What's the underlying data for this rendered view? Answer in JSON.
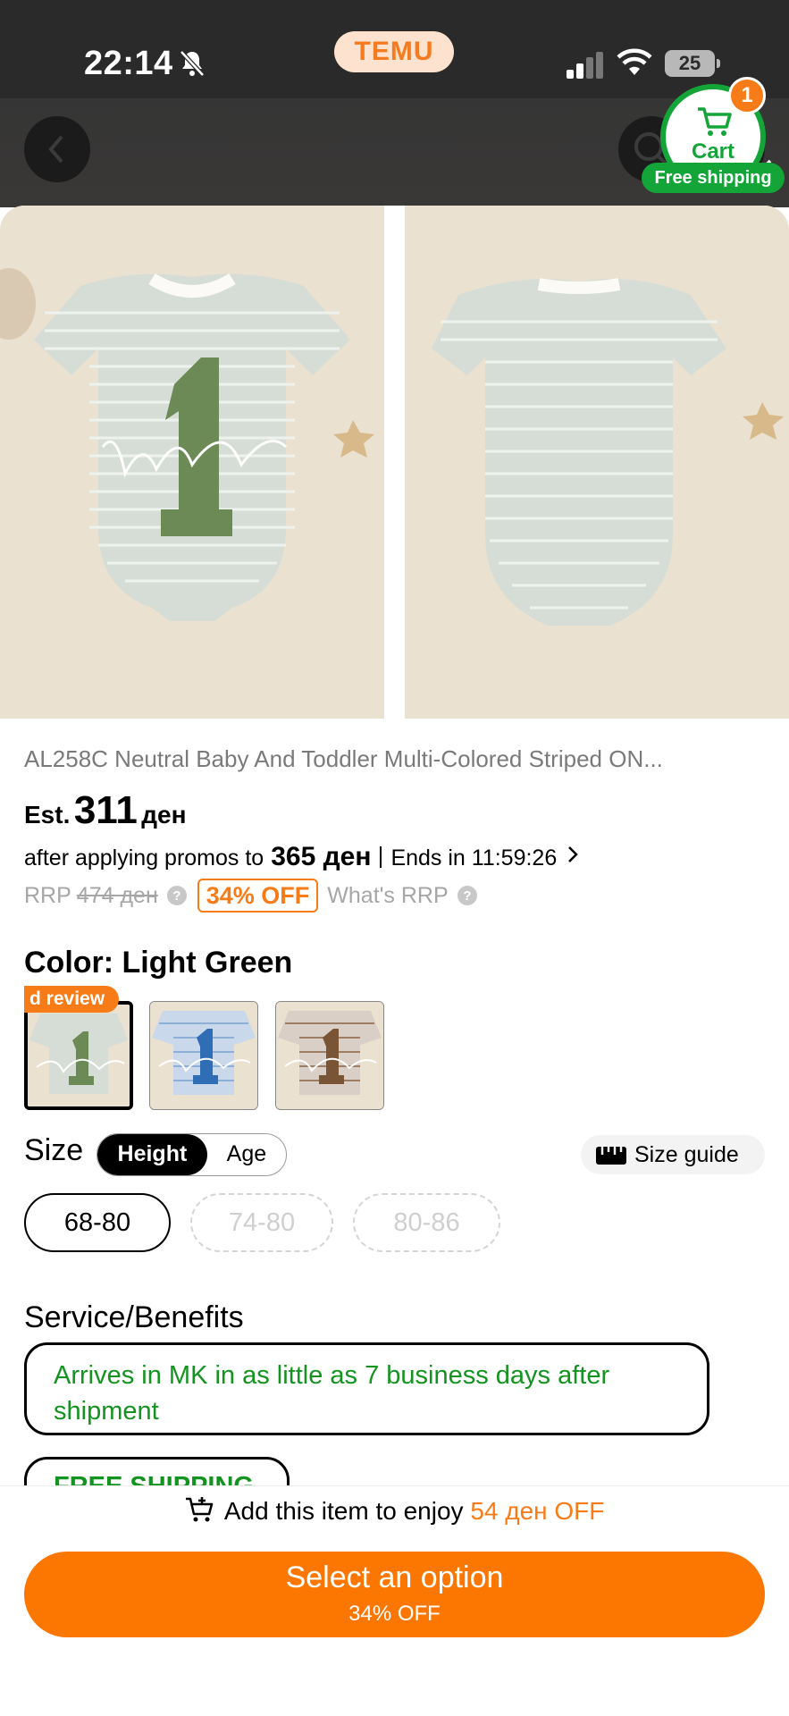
{
  "status_bar": {
    "time": "22:14",
    "brand": "TEMU",
    "battery": "25"
  },
  "cart": {
    "label": "Cart",
    "count": "1",
    "free_shipping": "Free shipping"
  },
  "product": {
    "title": "AL258C Neutral Baby And Toddler Multi-Colored Striped ON...",
    "est_label": "Est.",
    "price": "311",
    "currency": "ден",
    "promo_prefix": "after applying promos to",
    "promo_price": "365 ден",
    "ends_in": "Ends in 11:59:26",
    "rrp_label": "RRP",
    "rrp_value": "474 ден",
    "discount": "34% OFF",
    "whats_rrp": "What's RRP"
  },
  "color": {
    "title": "Color: Light Green",
    "swatch_badge": "d review",
    "swatches": [
      "Light Green",
      "Blue",
      "Brown"
    ]
  },
  "size": {
    "label": "Size",
    "toggle": [
      "Height",
      "Age"
    ],
    "guide": "Size guide",
    "options": [
      {
        "label": "68-80",
        "available": true
      },
      {
        "label": "74-80",
        "available": false
      },
      {
        "label": "80-86",
        "available": false
      }
    ]
  },
  "services": {
    "title": "Service/Benefits",
    "delivery": "Arrives in MK in as little as 7 business days after shipment",
    "free_shipping": "FREE SHIPPING"
  },
  "bottom": {
    "enjoy_prefix": "Add this item to enjoy",
    "enjoy_amount": "54 ден OFF",
    "cta_label": "Select an option",
    "cta_sub": "34% OFF"
  },
  "colors": {
    "accent": "#fb7701",
    "green": "#13a538",
    "photo_bg": "#e9dfcf"
  }
}
